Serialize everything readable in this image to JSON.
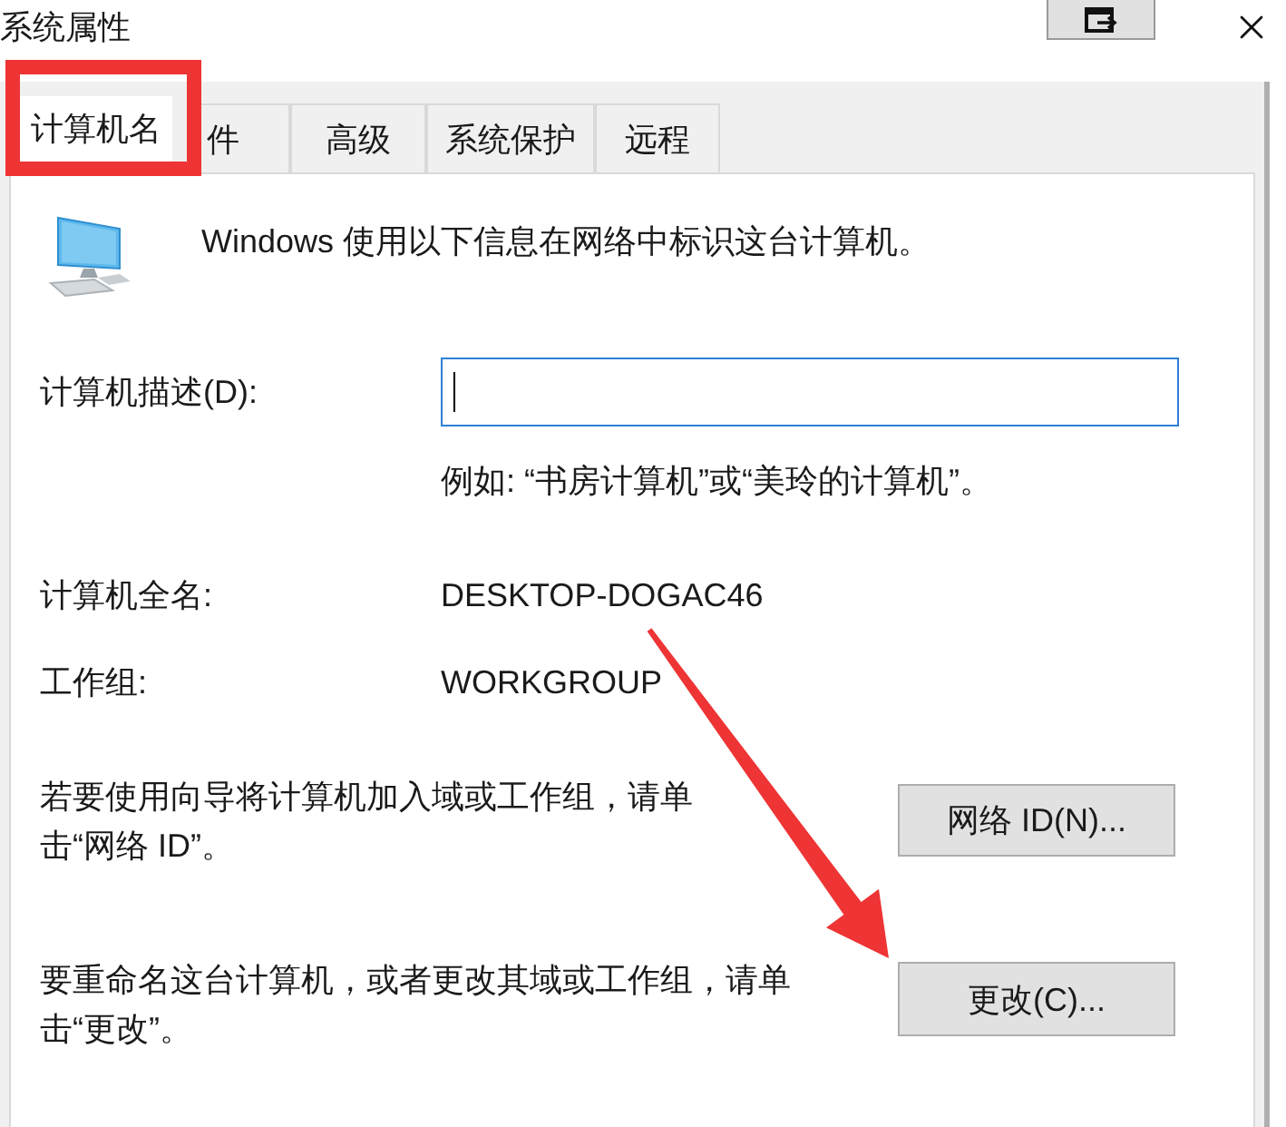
{
  "window": {
    "title": "系统属性"
  },
  "tabs": [
    {
      "label": "计算机名",
      "selected": true
    },
    {
      "label": "件",
      "selected": false
    },
    {
      "label": "高级",
      "selected": false
    },
    {
      "label": "系统保护",
      "selected": false
    },
    {
      "label": "远程",
      "selected": false
    }
  ],
  "intro": "Windows 使用以下信息在网络中标识这台计算机。",
  "description": {
    "label": "计算机描述(D):",
    "focused": true,
    "hint": "例如: “书房计算机”或“美玲的计算机”。"
  },
  "info_rows": [
    {
      "label": "计算机全名:",
      "value": "DESKTOP-DOGAC46"
    },
    {
      "label": "工作组:",
      "value": "WORKGROUP"
    }
  ],
  "actions": [
    {
      "text": "若要使用向导将计算机加入域或工作组，请单击“网络 ID”。",
      "button": "网络 ID(N)..."
    },
    {
      "text": "要重命名这台计算机，或者更改其域或工作组，请单击“更改”。",
      "button": "更改(C)..."
    }
  ]
}
